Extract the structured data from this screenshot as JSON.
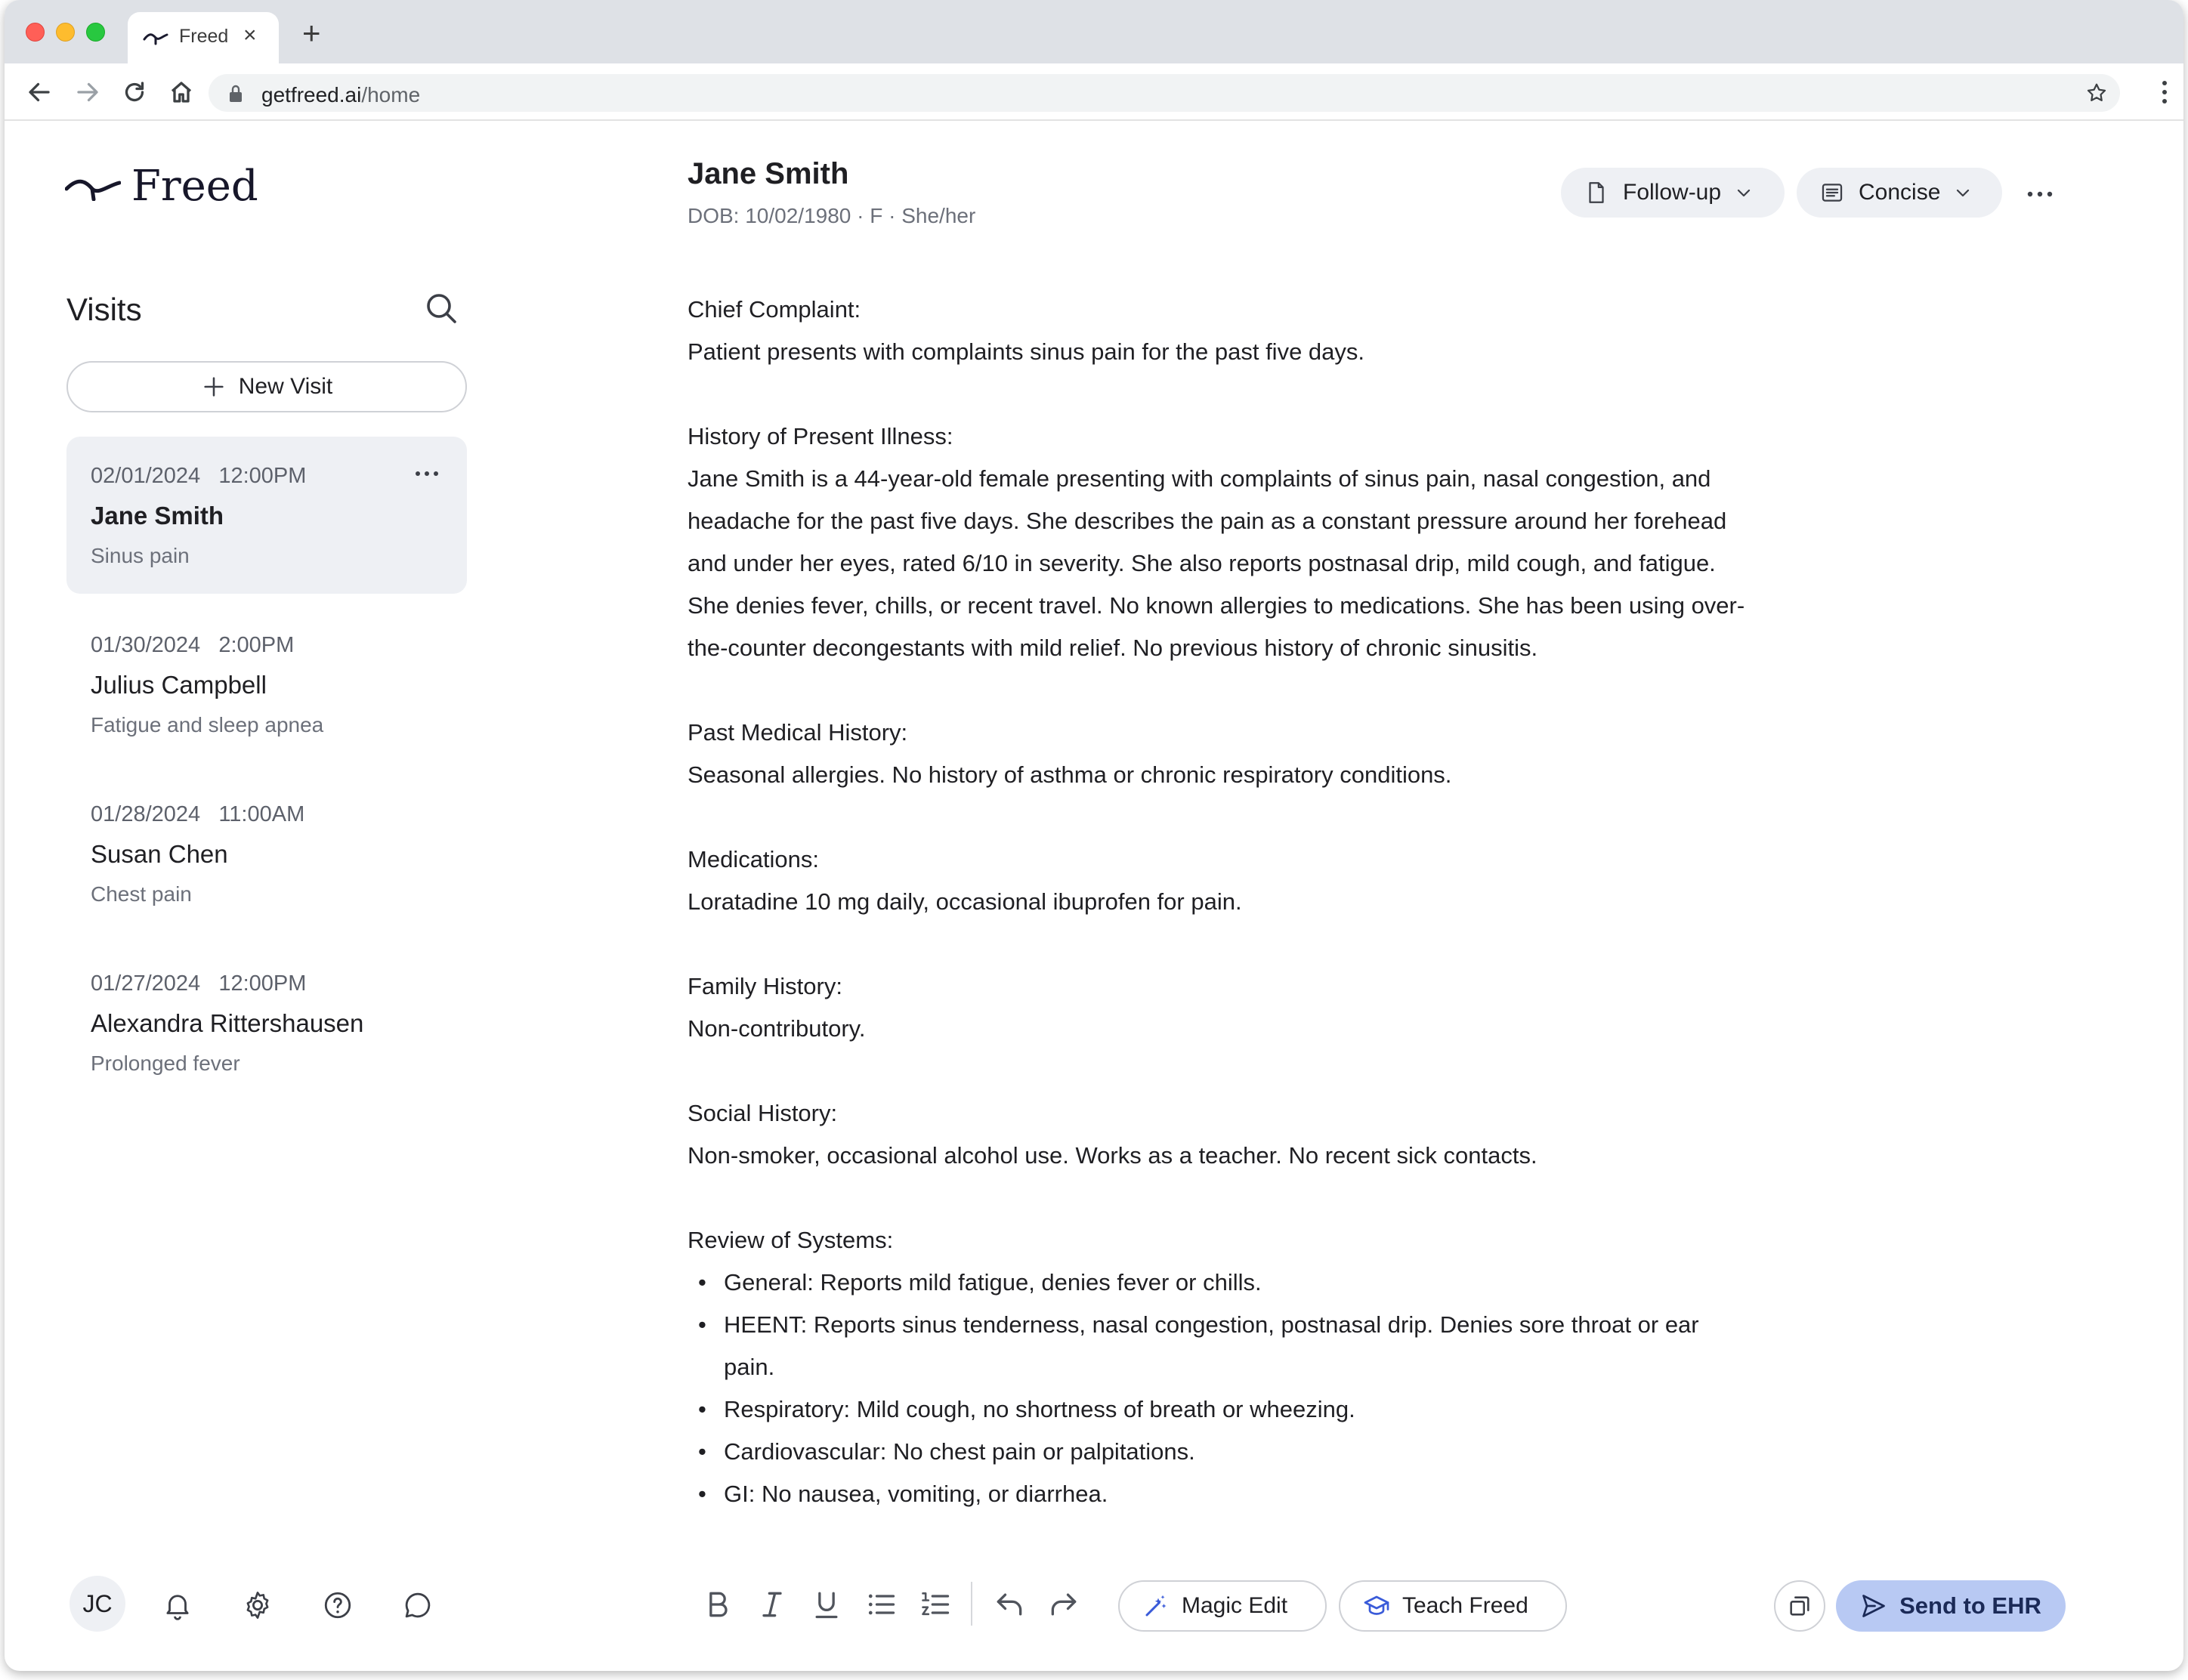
{
  "browser": {
    "tab_title": "Freed",
    "url_host": "getfreed.ai",
    "url_path": "/home"
  },
  "app": {
    "logo_text": "Freed",
    "visits_title": "Visits",
    "new_visit_label": "New Visit",
    "visits": [
      {
        "date": "02/01/2024   12:00PM",
        "name": "Jane Smith",
        "reason": "Sinus pain",
        "active": true
      },
      {
        "date": "01/30/2024   2:00PM",
        "name": "Julius Campbell",
        "reason": "Fatigue and sleep apnea",
        "active": false
      },
      {
        "date": "01/28/2024   11:00AM",
        "name": "Susan Chen",
        "reason": "Chest pain",
        "active": false
      },
      {
        "date": "01/27/2024   12:00PM",
        "name": "Alexandra Rittershausen",
        "reason": "Prolonged fever",
        "active": false
      }
    ],
    "user_initials": "JC"
  },
  "patient": {
    "name": "Jane Smith",
    "meta": "DOB: 10/02/1980 · F · She/her"
  },
  "header_controls": {
    "template_label": "Follow-up",
    "style_label": "Concise"
  },
  "note": {
    "cc_heading": "Chief Complaint:",
    "cc_text": "Patient presents with complaints sinus pain for the past five days.",
    "hpi_heading": "History of Present Illness:",
    "hpi_text": "Jane Smith is a 44-year-old female presenting with complaints of sinus pain, nasal congestion, and headache for the past five days. She describes the pain as a constant pressure around her forehead and under her eyes, rated 6/10 in severity. She also reports postnasal drip, mild cough, and fatigue. She denies fever, chills, or recent travel. No known allergies to medications. She has been using over-the-counter decongestants with mild relief. No previous history of chronic sinusitis.",
    "pmh_heading": "Past Medical History:",
    "pmh_text": "Seasonal allergies. No history of asthma or chronic respiratory conditions.",
    "meds_heading": "Medications:",
    "meds_text": "Loratadine 10 mg daily, occasional ibuprofen for pain.",
    "fh_heading": "Family History:",
    "fh_text": "Non-contributory.",
    "sh_heading": "Social History:",
    "sh_text": "Non-smoker, occasional alcohol use. Works as a teacher. No recent sick contacts.",
    "ros_heading": "Review of Systems:",
    "ros_items": [
      "General: Reports mild fatigue, denies fever or chills.",
      "HEENT: Reports sinus tenderness, nasal congestion, postnasal drip. Denies sore throat or ear pain.",
      "Respiratory: Mild cough, no shortness of breath or wheezing.",
      "Cardiovascular: No chest pain or palpitations.",
      "GI: No nausea, vomiting, or diarrhea."
    ]
  },
  "editor_toolbar": {
    "magic_edit_label": "Magic Edit",
    "teach_label": "Teach Freed",
    "send_label": "Send to EHR"
  },
  "colors": {
    "send_button_bg": "#b8c9f3",
    "active_visit_bg": "#eef0f4",
    "magic_icon": "#3a5bd9"
  }
}
